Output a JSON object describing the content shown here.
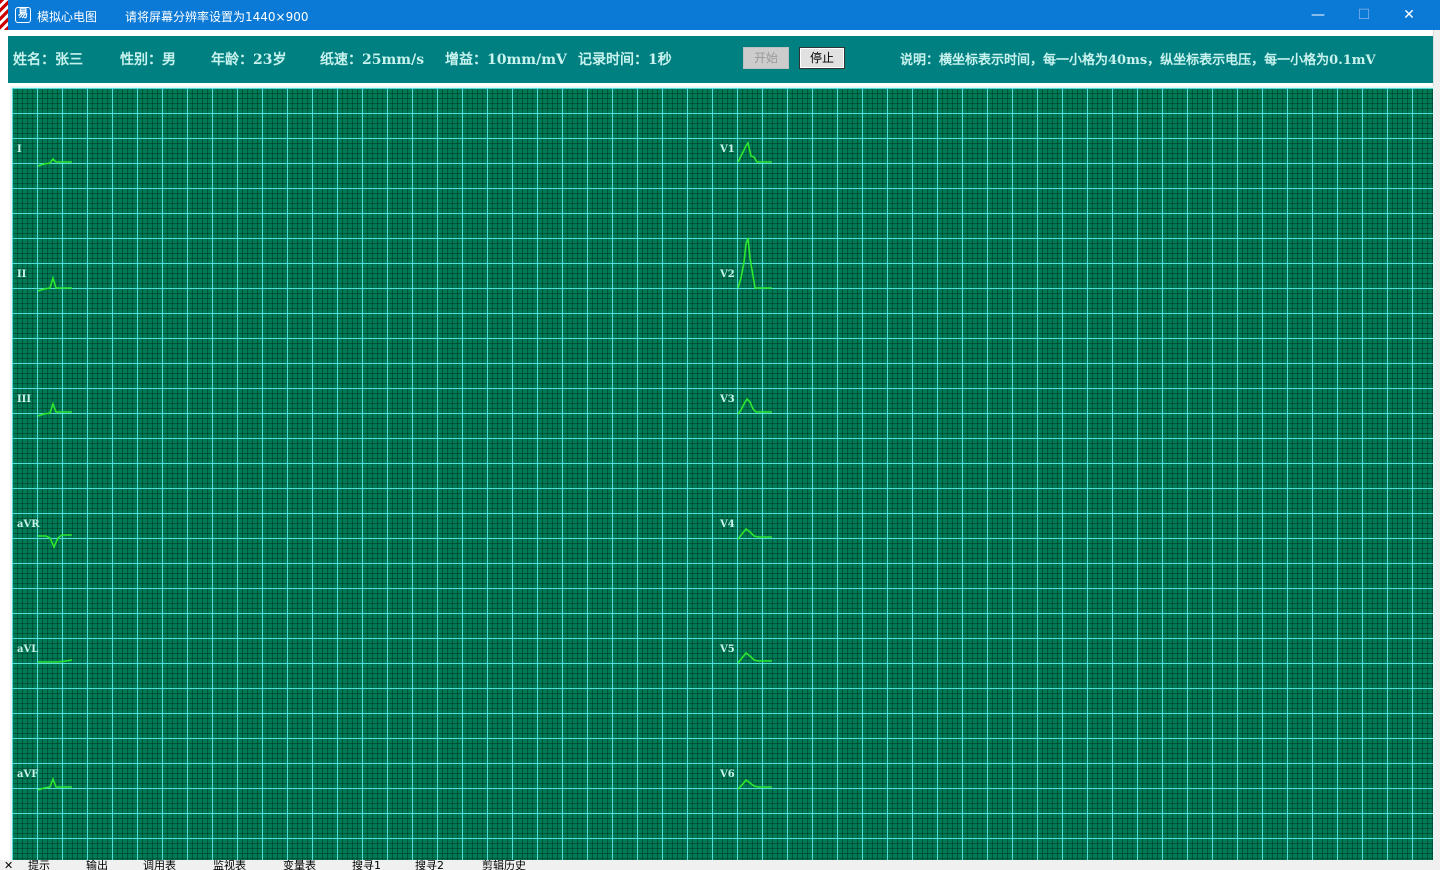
{
  "window": {
    "icon_glyph": "易",
    "icon": "app-icon",
    "title": "模拟心电图",
    "hint": "请将屏幕分辨率设置为1440×900",
    "minimize_glyph": "—",
    "maximize_glyph": "☐",
    "close_glyph": "✕"
  },
  "info": {
    "name": "姓名：张三",
    "gender": "性别：男",
    "age": "年龄：23岁",
    "paper_speed": "纸速：25mm/s",
    "gain": "增益：10mm/mV",
    "record_time": "记录时间：1秒",
    "description": "说明：横坐标表示时间，每一小格为40ms，纵坐标表示电压，每一小格为0.1mV"
  },
  "buttons": {
    "start": "开始",
    "stop": "停止"
  },
  "leads": [
    "I",
    "II",
    "III",
    "aVR",
    "aVL",
    "aVF",
    "V1",
    "V2",
    "V3",
    "V4",
    "V5",
    "V6"
  ],
  "colors": {
    "grid_background": "#007a55",
    "grid_line": "#5ee9ec",
    "trace": "#2ee82e",
    "label": "#c9f5ee",
    "infobar": "#008080"
  },
  "bottom_tabs": [
    "提示",
    "输出",
    "调用表",
    "监视表",
    "变量表",
    "搜寻1",
    "搜寻2",
    "剪辑历史"
  ]
}
